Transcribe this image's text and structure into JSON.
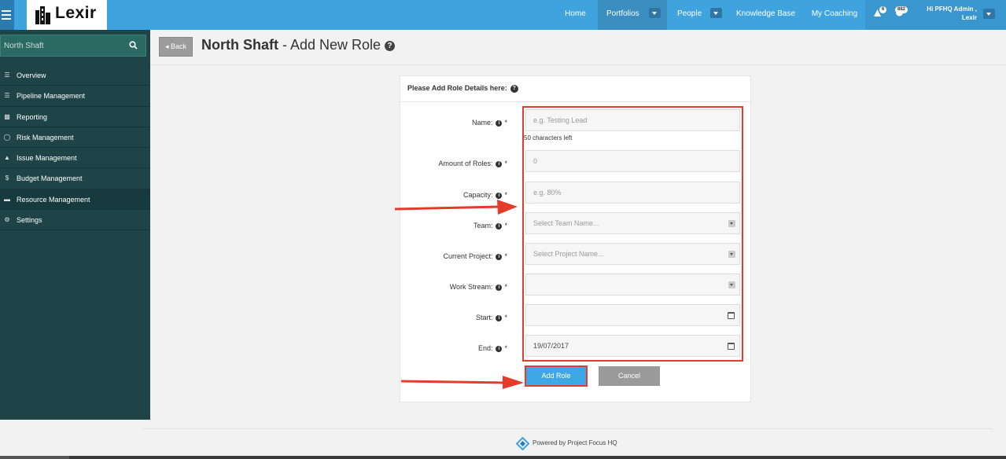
{
  "app": {
    "logo_text": "Lexir"
  },
  "nav": {
    "items": [
      {
        "label": "Home"
      },
      {
        "label": "Portfolios"
      },
      {
        "label": "People"
      },
      {
        "label": "Knowledge Base"
      },
      {
        "label": "My Coaching"
      }
    ],
    "alerts_count": "6",
    "messages_count": "882",
    "user_greeting_line1": "Hi PFHQ Admin ,",
    "user_greeting_line2": "Lexir"
  },
  "sidebar": {
    "search_text": "North Shaft",
    "items": [
      {
        "label": "Overview",
        "icon": "list-icon"
      },
      {
        "label": "Pipeline Management",
        "icon": "list-icon"
      },
      {
        "label": "Reporting",
        "icon": "bar-chart-icon"
      },
      {
        "label": "Risk Management",
        "icon": "lightbulb-icon"
      },
      {
        "label": "Issue Management",
        "icon": "warning-icon"
      },
      {
        "label": "Budget Management",
        "icon": "dollar-icon"
      },
      {
        "label": "Resource Management",
        "icon": "folder-icon",
        "active": true
      },
      {
        "label": "Settings",
        "icon": "gears-icon"
      }
    ]
  },
  "page": {
    "back_label": "Back",
    "title_bold": "North Shaft",
    "title_rest": " - Add New Role "
  },
  "form": {
    "heading": "Please Add Role Details here:",
    "fields": [
      {
        "label": "Name:",
        "placeholder": "e.g. Testing Lead",
        "value": ""
      },
      {
        "label": "Amount of Roles:",
        "placeholder": "0",
        "value": ""
      },
      {
        "label": "Capacity:",
        "placeholder": "e.g. 80%",
        "value": ""
      },
      {
        "label": "Team:",
        "placeholder": "Select Team Name...",
        "value": ""
      },
      {
        "label": "Current Project:",
        "placeholder": "Select Project Name...",
        "value": ""
      },
      {
        "label": "Work Stream:",
        "placeholder": "",
        "value": ""
      },
      {
        "label": "Start:",
        "placeholder": "",
        "value": ""
      },
      {
        "label": "End:",
        "placeholder": "",
        "value": "19/07/2017"
      }
    ],
    "chars_left": "50 characters left",
    "required_mark": "*",
    "add_button": "Add Role",
    "cancel_button": "Cancel"
  },
  "footer": {
    "text": "Powered by Project Focus HQ"
  },
  "colors": {
    "topbar": "#3fa3dd",
    "sidebar": "#1e4448",
    "highlight": "#e53b2a",
    "primary_button": "#3ea8e6"
  }
}
